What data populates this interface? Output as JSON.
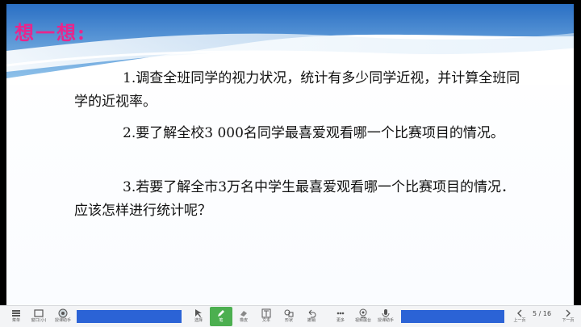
{
  "slide": {
    "title": "想一想:",
    "paragraphs": [
      "1.调查全班同学的视力状况，统计有多少同学近视，并计算全班同学的近视率。",
      "2.要了解全校3 000名同学最喜爱观看哪一个比赛项目的情况。",
      "3.若要了解全市3万名中学生最喜爱观看哪一个比赛项目的情况．应该怎样进行统计呢？"
    ]
  },
  "toolbar": {
    "left": [
      {
        "label": "菜单",
        "icon": "menu-icon"
      },
      {
        "label": "窗口(小)",
        "icon": "window-icon"
      },
      {
        "label": "授课助手",
        "icon": "assistant-icon"
      }
    ],
    "center": [
      {
        "label": "选择",
        "icon": "cursor-icon"
      },
      {
        "label": "笔",
        "icon": "pen-icon"
      },
      {
        "label": "橡皮",
        "icon": "eraser-icon"
      },
      {
        "label": "文本",
        "icon": "text-icon"
      },
      {
        "label": "形状",
        "icon": "shape-icon"
      },
      {
        "label": "撤销",
        "icon": "undo-icon"
      },
      {
        "label": "更多",
        "icon": "more-icon"
      },
      {
        "label": "视频展台",
        "icon": "camera-icon"
      },
      {
        "label": "授课助手",
        "icon": "mic-icon"
      }
    ],
    "page_indicator": "5 / 16",
    "right": [
      {
        "label": "上一页",
        "icon": "prev-icon"
      },
      {
        "label": "页码",
        "icon": "page-icon"
      },
      {
        "label": "下一页",
        "icon": "next-icon"
      }
    ]
  },
  "colors": {
    "title": "#e8268c",
    "accent_bar": "#2b63d6",
    "active_tool": "#4caf50"
  }
}
